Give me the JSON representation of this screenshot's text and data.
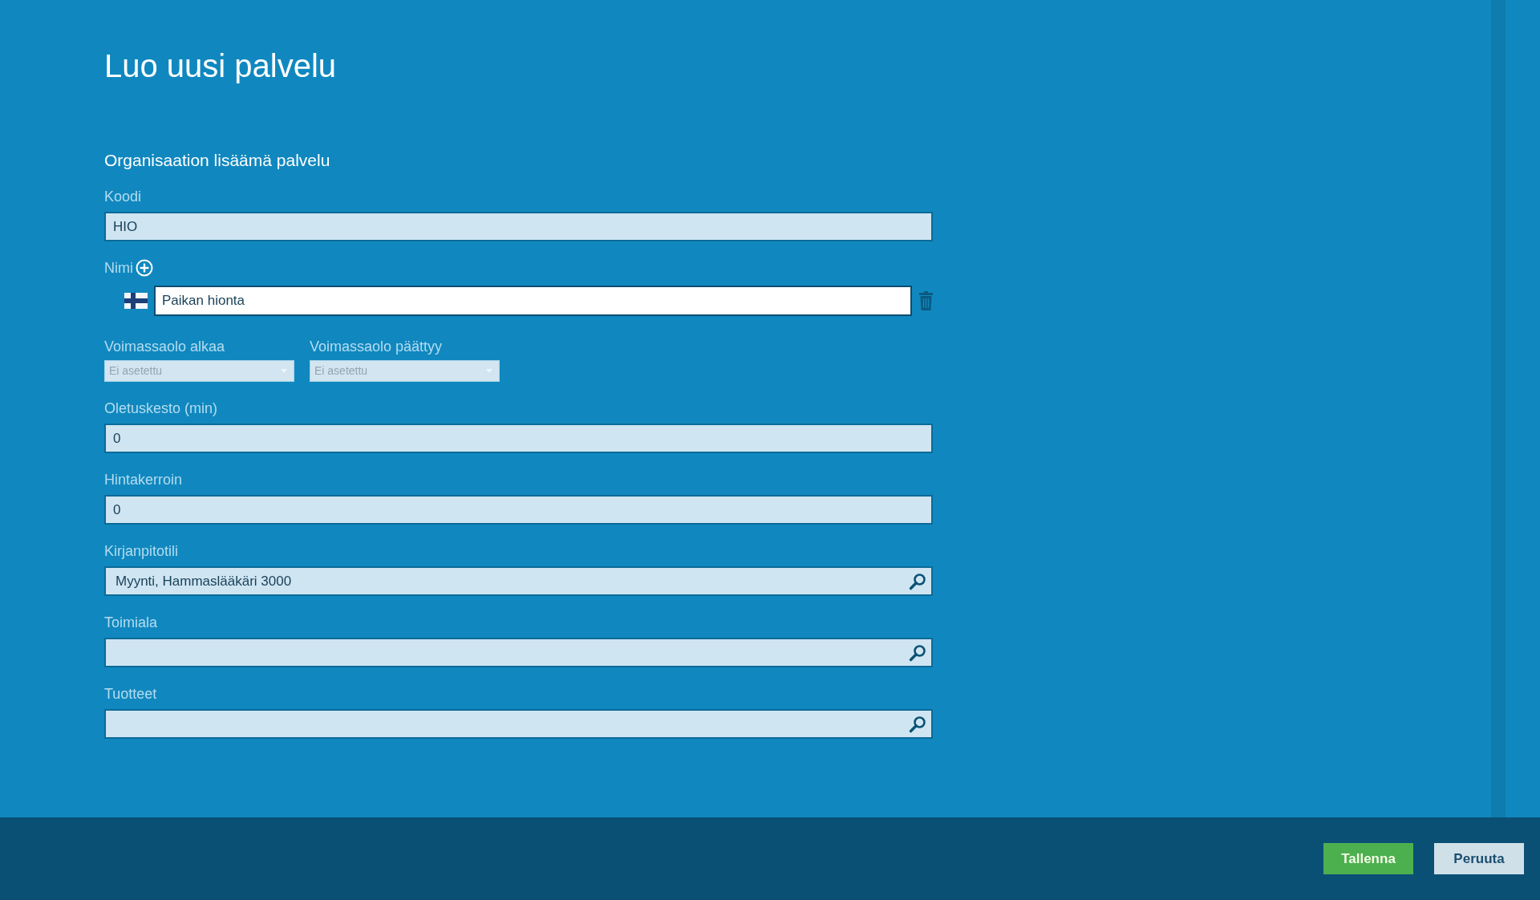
{
  "page_title": "Luo uusi palvelu",
  "section_title": "Organisaation lisäämä palvelu",
  "fields": [
    {
      "kind": "text",
      "label": "Koodi",
      "value": "HIO"
    },
    {
      "kind": "names",
      "label": "Nimi",
      "entries": [
        {
          "value": "Paikan hionta"
        }
      ]
    },
    {
      "kind": "dates",
      "selects": [
        {
          "label": "Voimassaolo alkaa",
          "value": "Ei asetettu"
        },
        {
          "label": "Voimassaolo päättyy",
          "value": "Ei asetettu"
        }
      ]
    },
    {
      "kind": "text",
      "label": "Oletuskesto (min)",
      "value": "0"
    },
    {
      "kind": "text",
      "label": "Hintakerroin",
      "value": "0"
    },
    {
      "kind": "search",
      "label": "Kirjanpitotili",
      "value": "Myynti, Hammaslääkäri 3000"
    },
    {
      "kind": "search",
      "label": "Toimiala"
    },
    {
      "kind": "search",
      "label": "Tuotteet"
    }
  ],
  "buttons": [
    {
      "kind": "primary",
      "label": "Tallenna"
    },
    {
      "kind": "secondary",
      "label": "Peruuta"
    }
  ]
}
